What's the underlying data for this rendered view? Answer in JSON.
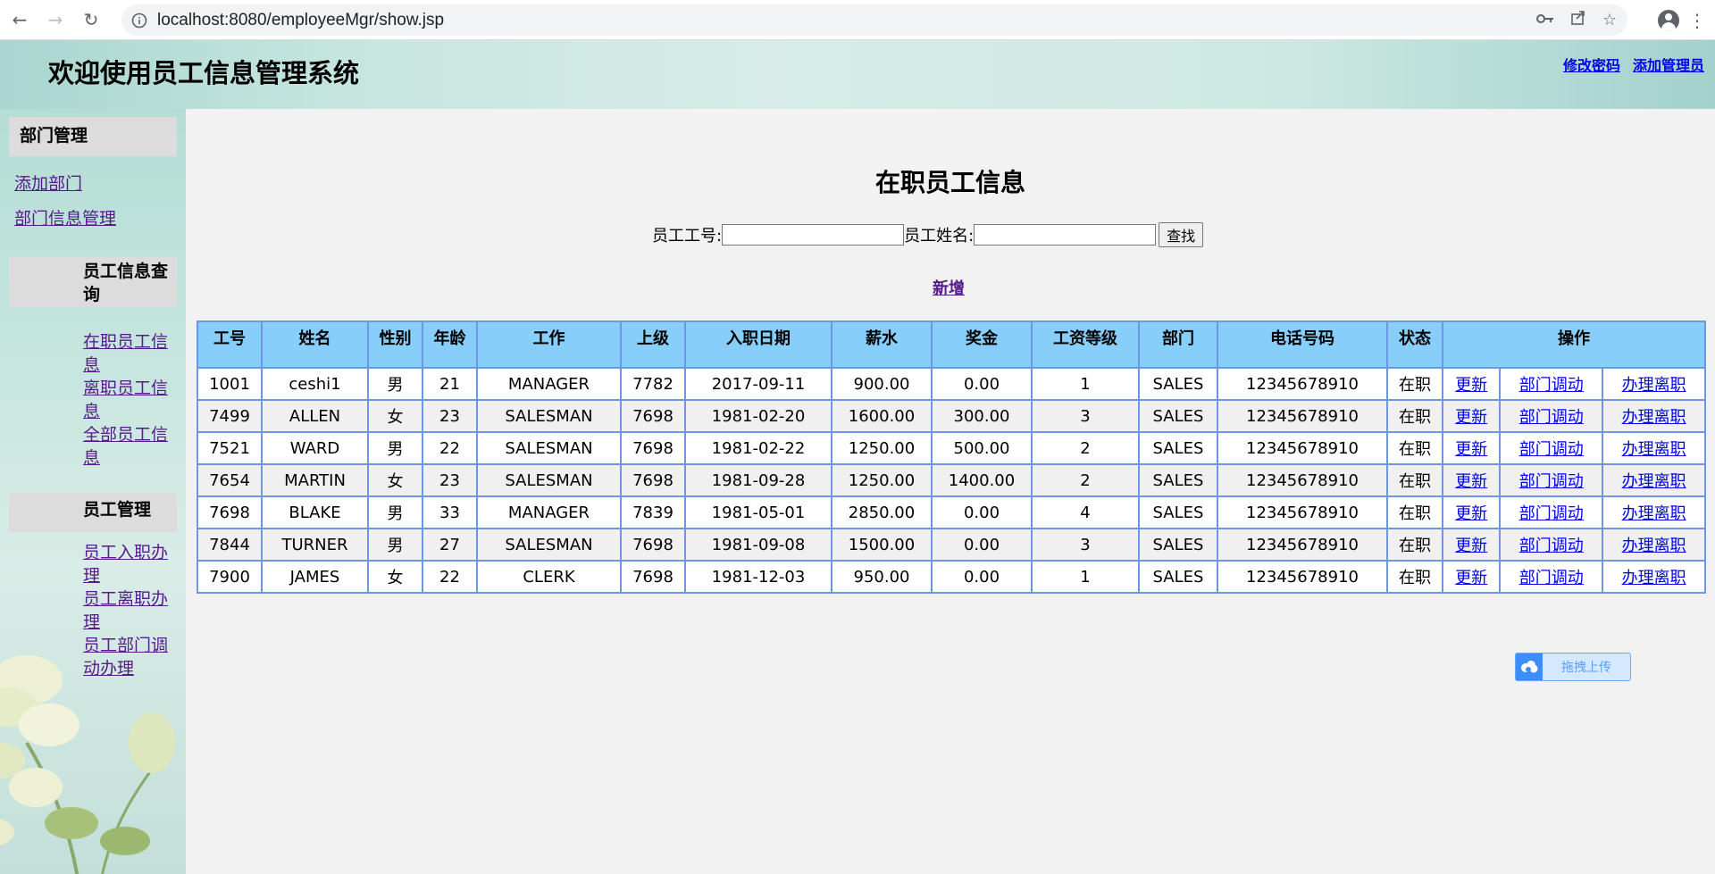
{
  "browser": {
    "url": "localhost:8080/employeeMgr/show.jsp"
  },
  "header": {
    "title": "欢迎使用员工信息管理系统",
    "links": [
      "修改密码",
      "添加管理员"
    ]
  },
  "sidebar": {
    "sections": [
      {
        "title": "部门管理",
        "items": [
          "添加部门",
          "部门信息管理"
        ]
      },
      {
        "title": "员工信息查询",
        "items": [
          "在职员工信息",
          "离职员工信息",
          "全部员工信息"
        ]
      },
      {
        "title": "员工管理",
        "items": [
          "员工入职办理",
          "员工离职办理",
          "员工部门调动办理"
        ]
      }
    ]
  },
  "main": {
    "title": "在职员工信息",
    "search": {
      "id_label": "员工工号:",
      "name_label": "员工姓名:",
      "id_value": "",
      "name_value": "",
      "button": "查找"
    },
    "add_link": "新增",
    "table": {
      "headers": [
        "工号",
        "姓名",
        "性别",
        "年龄",
        "工作",
        "上级",
        "入职日期",
        "薪水",
        "奖金",
        "工资等级",
        "部门",
        "电话号码",
        "状态",
        "操作"
      ],
      "actions": [
        "更新",
        "部门调动",
        "办理离职"
      ],
      "rows": [
        [
          "1001",
          "ceshi1",
          "男",
          "21",
          "MANAGER",
          "7782",
          "2017-09-11",
          "900.00",
          "0.00",
          "1",
          "SALES",
          "12345678910",
          "在职"
        ],
        [
          "7499",
          "ALLEN",
          "女",
          "23",
          "SALESMAN",
          "7698",
          "1981-02-20",
          "1600.00",
          "300.00",
          "3",
          "SALES",
          "12345678910",
          "在职"
        ],
        [
          "7521",
          "WARD",
          "男",
          "22",
          "SALESMAN",
          "7698",
          "1981-02-22",
          "1250.00",
          "500.00",
          "2",
          "SALES",
          "12345678910",
          "在职"
        ],
        [
          "7654",
          "MARTIN",
          "女",
          "23",
          "SALESMAN",
          "7698",
          "1981-09-28",
          "1250.00",
          "1400.00",
          "2",
          "SALES",
          "12345678910",
          "在职"
        ],
        [
          "7698",
          "BLAKE",
          "男",
          "33",
          "MANAGER",
          "7839",
          "1981-05-01",
          "2850.00",
          "0.00",
          "4",
          "SALES",
          "12345678910",
          "在职"
        ],
        [
          "7844",
          "TURNER",
          "男",
          "27",
          "SALESMAN",
          "7698",
          "1981-09-08",
          "1500.00",
          "0.00",
          "3",
          "SALES",
          "12345678910",
          "在职"
        ],
        [
          "7900",
          "JAMES",
          "女",
          "22",
          "CLERK",
          "7698",
          "1981-12-03",
          "950.00",
          "0.00",
          "1",
          "SALES",
          "12345678910",
          "在职"
        ]
      ]
    },
    "upload_widget": "拖拽上传"
  },
  "colors": {
    "table_header": "#87cefa",
    "table_border": "#6f96e6",
    "link": "#0000ee",
    "visited_link": "#551a8b"
  }
}
